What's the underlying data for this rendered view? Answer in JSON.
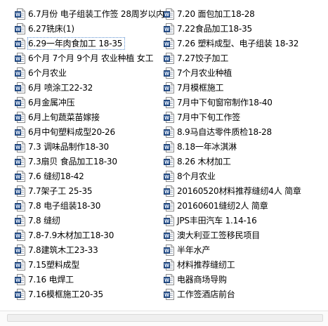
{
  "file_list": {
    "left_column": [
      {
        "label": "6.7月份 电子组装工作签 28周岁以内",
        "icon": "word-document-icon"
      },
      {
        "label": "6.27铣床(1)",
        "icon": "word-document-icon"
      },
      {
        "label": "6.29一年肉食加工 18-35",
        "icon": "word-document-icon",
        "focused": true
      },
      {
        "label": "6个月 7个月 9个月 农业种植 女工",
        "icon": "word-document-icon"
      },
      {
        "label": "6个月农业",
        "icon": "word-document-icon"
      },
      {
        "label": "6月 喷涂工22-32",
        "icon": "word-document-icon"
      },
      {
        "label": "6月金属冲压",
        "icon": "word-document-icon"
      },
      {
        "label": "6月上旬蔬菜苗嫁接",
        "icon": "word-document-icon"
      },
      {
        "label": "6月中旬塑料成型20-26",
        "icon": "word-document-icon"
      },
      {
        "label": "7.3 调味品制作18-30",
        "icon": "word-document-icon"
      },
      {
        "label": "7.3扇贝 食品加工18-30",
        "icon": "word-document-icon"
      },
      {
        "label": "7.6 缝纫18-42",
        "icon": "word-document-icon"
      },
      {
        "label": "7.7架子工  25-35",
        "icon": "word-document-icon"
      },
      {
        "label": "7.8 电子组装18-30",
        "icon": "word-document-icon"
      },
      {
        "label": "7.8 缝纫",
        "icon": "word-document-icon"
      },
      {
        "label": "7.8-7.9木材加工18-30",
        "icon": "word-document-icon"
      },
      {
        "label": "7.8建筑木工23-33",
        "icon": "word-document-icon"
      },
      {
        "label": "7.15塑料成型",
        "icon": "word-document-icon"
      },
      {
        "label": "7.16 电焊工",
        "icon": "word-document-icon"
      },
      {
        "label": "7.16模框施工20-35",
        "icon": "word-document-icon"
      }
    ],
    "right_column": [
      {
        "label": "7.20 面包加工18-28",
        "icon": "word-document-icon"
      },
      {
        "label": "7.22食品加工18-35",
        "icon": "word-document-icon"
      },
      {
        "label": "7.26 塑料成型、电子组装 18-32",
        "icon": "word-document-icon"
      },
      {
        "label": "7.27饺子加工",
        "icon": "word-document-icon"
      },
      {
        "label": "7个月农业种植",
        "icon": "word-document-icon"
      },
      {
        "label": "7月模框施工",
        "icon": "word-document-icon"
      },
      {
        "label": "7月中下旬窗帘制作18-40",
        "icon": "word-document-icon"
      },
      {
        "label": "7月中下旬工作签",
        "icon": "word-document-icon"
      },
      {
        "label": "8.9马自达零件质检18-28",
        "icon": "word-document-icon"
      },
      {
        "label": "8.18一年冰淇淋",
        "icon": "word-document-icon"
      },
      {
        "label": "8.26 木材加工",
        "icon": "word-document-icon"
      },
      {
        "label": "8个月农业",
        "icon": "word-document-icon"
      },
      {
        "label": "20160520材料推荐缝纫4人 简章",
        "icon": "word-document-icon"
      },
      {
        "label": "20160601缝纫2人 简章",
        "icon": "word-document-icon"
      },
      {
        "label": "JPS丰田汽车 1.14-16",
        "icon": "word-document-icon"
      },
      {
        "label": "澳大利亚工签移民项目",
        "icon": "word-document-icon"
      },
      {
        "label": "半年水产",
        "icon": "word-document-icon"
      },
      {
        "label": "材料推荐缝纫工",
        "icon": "word-document-icon"
      },
      {
        "label": "电器商场导购",
        "icon": "word-document-icon"
      },
      {
        "label": "工作签酒店前台",
        "icon": "word-document-icon"
      }
    ]
  },
  "colors": {
    "icon_blue": "#2b5797",
    "icon_page": "#ffffff",
    "focus_outline": "#5a8fd0"
  }
}
